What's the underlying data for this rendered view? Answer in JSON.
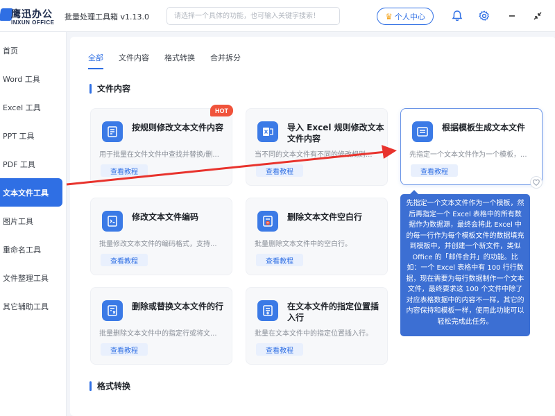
{
  "app": {
    "logo_cn": "鹰迅办公",
    "logo_en": "INXUN OFFICE",
    "title": "批量处理工具箱 v1.13.0"
  },
  "search": {
    "placeholder": "请选择一个具体的功能，也可输入关键字搜索！"
  },
  "user_center": {
    "label": "个人中心",
    "icon": "crown-icon"
  },
  "top_icons": [
    "bell-icon",
    "settings-icon",
    "minimize-icon",
    "collapse-icon"
  ],
  "sidebar": {
    "items": [
      {
        "label": "首页",
        "active": false
      },
      {
        "label": "Word 工具",
        "active": false
      },
      {
        "label": "Excel 工具",
        "active": false
      },
      {
        "label": "PPT 工具",
        "active": false
      },
      {
        "label": "PDF 工具",
        "active": false
      },
      {
        "label": "文本文件工具",
        "active": true
      },
      {
        "label": "图片工具",
        "active": false
      },
      {
        "label": "重命名工具",
        "active": false
      },
      {
        "label": "文件整理工具",
        "active": false
      },
      {
        "label": "其它辅助工具",
        "active": false
      }
    ]
  },
  "tabs": [
    {
      "label": "全部",
      "active": true
    },
    {
      "label": "文件内容",
      "active": false
    },
    {
      "label": "格式转换",
      "active": false
    },
    {
      "label": "合并拆分",
      "active": false
    }
  ],
  "sections": {
    "content": "文件内容",
    "format": "格式转换"
  },
  "cards": [
    {
      "title": "按规则修改文本文件内容",
      "desc": "用于批量在文件文件中查找并替换/删...",
      "btn": "查看教程",
      "badge": "HOT",
      "icon": "edit-doc-icon"
    },
    {
      "title": "导入 Excel 规则修改文本文件内容",
      "desc": "当不同的文本文件有不同的修改规则...",
      "btn": "查看教程",
      "badge": "",
      "icon": "excel-import-icon"
    },
    {
      "title": "根据模板生成文本文件",
      "desc": "先指定一个文本文件作为一个模板，...",
      "btn": "查看教程",
      "badge": "",
      "icon": "template-icon"
    },
    {
      "title": "修改文本文件编码",
      "desc": "批量修改文本文件的编码格式，支持...",
      "btn": "查看教程",
      "badge": "",
      "icon": "encoding-icon"
    },
    {
      "title": "删除文本文件空白行",
      "desc": "批量删除文本文件中的空白行。",
      "btn": "查看教程",
      "badge": "",
      "icon": "delete-blank-icon"
    },
    {
      "title": "删除或替换文本文件的行",
      "desc": "批量删除文本文件中的指定行或将文...",
      "btn": "查看教程",
      "badge": "",
      "icon": "replace-line-icon"
    },
    {
      "title": "在文本文件的指定位置插入行",
      "desc": "批量在文本文件中的指定位置插入行。",
      "btn": "查看教程",
      "badge": "",
      "icon": "insert-line-icon"
    }
  ],
  "tooltip": {
    "text": "先指定一个文本文件作为一个模板，然后再指定一个 Excel 表格中的所有数据作为数据源，最终会将此 Excel 中的每一行作为每个模板文件的数据填充到模板中，并创建一个新文件，类似 Office 的「邮件合并」的功能。比如：一个 Excel 表格中有 100 行行数据，现在需要为每行数据制作一个文本文件，最终要求这 100 个文件中除了对应表格数据中的内容不一样，其它的内容保持和模板一样，使用此功能可以轻松完成此任务。"
  },
  "colors": {
    "accent": "#2f6fe4",
    "hot": "#f0533b",
    "arrow": "#e8332d",
    "tooltip": "#3c6fd3"
  }
}
